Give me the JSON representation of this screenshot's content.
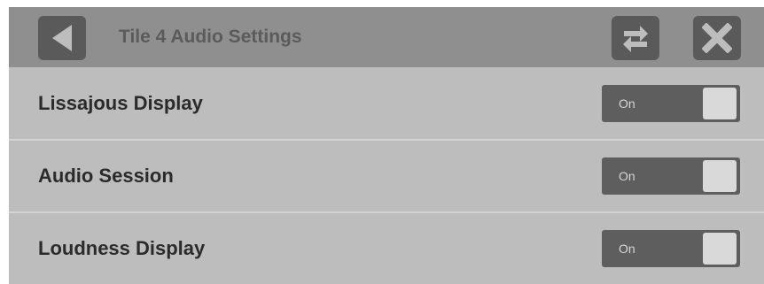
{
  "header": {
    "title": "Tile 4 Audio Settings",
    "back_icon": "back-arrow-icon",
    "swap_icon": "swap-arrows-icon",
    "close_icon": "close-x-icon"
  },
  "settings": [
    {
      "label": "Lissajous Display",
      "state": "On"
    },
    {
      "label": "Audio Session",
      "state": "On"
    },
    {
      "label": "Loudness Display",
      "state": "On"
    }
  ],
  "colors": {
    "header_bg": "#8f8f8f",
    "panel_bg": "#bdbdbd",
    "button_bg": "#5a5a5a",
    "toggle_bg": "#5e5e5e",
    "toggle_knob": "#d9d9d9"
  }
}
